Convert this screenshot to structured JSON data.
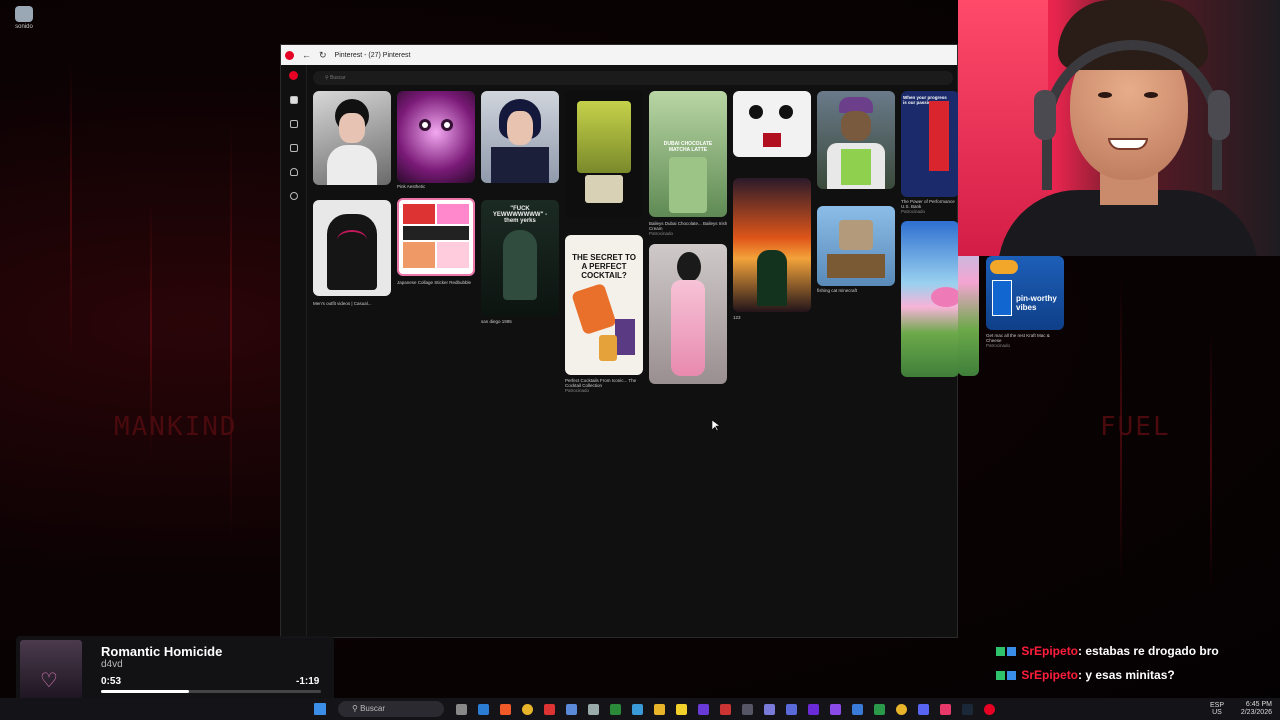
{
  "desktop": {
    "icon_label": "sonido",
    "left_word": "MANKIND",
    "right_word": "FUEL"
  },
  "browser": {
    "tab_title": "Pinterest - (27) Pinterest",
    "search_placeholder": "Buscar",
    "pins": [
      {
        "caption": "",
        "sponsored": ""
      },
      {
        "caption": "Pink Aesthetic",
        "sponsored": ""
      },
      {
        "caption": "",
        "sponsored": ""
      },
      {
        "caption": "",
        "sponsored": ""
      },
      {
        "caption": "Baileys Dubai Chocolate... Baileys Irish Cream",
        "sponsored": "Patrocinado",
        "overlay": "DUBAI CHOCOLATE MATCHA LATTE"
      },
      {
        "caption": "",
        "sponsored": ""
      },
      {
        "caption": "",
        "sponsored": ""
      },
      {
        "caption": "The Power of Performance U.S. Bank",
        "sponsored": "Patrocinado",
        "overlay": "When your progress is our passion."
      },
      {
        "caption": "Men's outfit videos | Casual...",
        "sponsored": ""
      },
      {
        "caption": "Japanese Collage Sticker Redbubble",
        "sponsored": ""
      },
      {
        "caption": "san diego 1995",
        "sponsored": "",
        "overlay": "\"FUCK YEWWWWWWW\" - them yerks"
      },
      {
        "caption": "Perfect Cocktails From Iconic... The Cocktail Collection",
        "sponsored": "Patrocinado",
        "overlay": "THE SECRET TO A PERFECT COCKTAIL?"
      },
      {
        "caption": "",
        "sponsored": ""
      },
      {
        "caption": "123",
        "sponsored": ""
      },
      {
        "caption": "fishing cat minecraft",
        "sponsored": ""
      },
      {
        "caption": "",
        "sponsored": ""
      },
      {
        "caption": "Get mac all the rest Kraft Mac & Cheese",
        "sponsored": "Patrocinado",
        "overlay": "pin-worthy vibes"
      }
    ]
  },
  "music": {
    "title": "Romantic Homicide",
    "artist": "d4vd",
    "elapsed": "0:53",
    "remaining": "-1:19",
    "progress": 0.4
  },
  "chat": [
    {
      "user": "SrEpipeto",
      "message": ": estabas re drogado bro"
    },
    {
      "user": "SrEpipeto",
      "message": ": y esas minitas?"
    }
  ],
  "taskbar": {
    "search_label": "Buscar",
    "lang": "ESP",
    "region": "US",
    "time": "6:45 PM",
    "date": "2/23/2026"
  },
  "colors": {
    "pinterest_red": "#e60023",
    "chat_user": "#ff1e3c"
  }
}
